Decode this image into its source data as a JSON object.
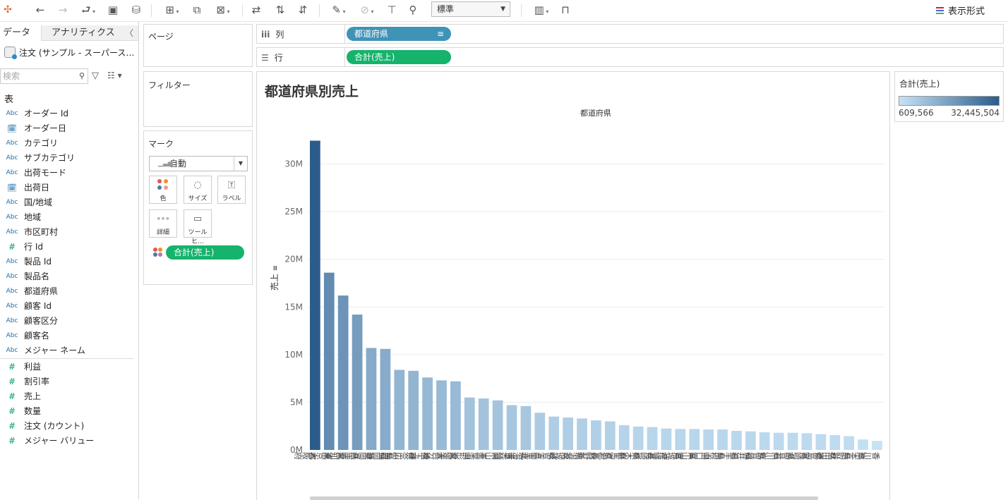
{
  "toolbar": {
    "view_mode": "標準",
    "show_me": "表示形式"
  },
  "data_pane": {
    "tab_data": "データ",
    "tab_analytics": "アナリティクス",
    "datasource": "注文 (サンプル - スーパース…",
    "search_placeholder": "検索",
    "table_label": "表",
    "dimensions": [
      {
        "type": "Abc",
        "name": "オーダー Id"
      },
      {
        "type": "date",
        "name": "オーダー日"
      },
      {
        "type": "Abc",
        "name": "カテゴリ"
      },
      {
        "type": "Abc",
        "name": "サブカテゴリ"
      },
      {
        "type": "Abc",
        "name": "出荷モード"
      },
      {
        "type": "date",
        "name": "出荷日"
      },
      {
        "type": "Abc",
        "name": "国/地域"
      },
      {
        "type": "Abc",
        "name": "地域"
      },
      {
        "type": "Abc",
        "name": "市区町村"
      },
      {
        "type": "#",
        "name": "行 Id"
      },
      {
        "type": "Abc",
        "name": "製品 Id"
      },
      {
        "type": "Abc",
        "name": "製品名"
      },
      {
        "type": "Abc",
        "name": "都道府県"
      },
      {
        "type": "Abc",
        "name": "顧客 Id"
      },
      {
        "type": "Abc",
        "name": "顧客区分"
      },
      {
        "type": "Abc",
        "name": "顧客名"
      },
      {
        "type": "Abc",
        "name": "メジャー ネーム"
      }
    ],
    "measures": [
      {
        "type": "#",
        "name": "利益"
      },
      {
        "type": "#",
        "name": "割引率"
      },
      {
        "type": "#",
        "name": "売上"
      },
      {
        "type": "#",
        "name": "数量"
      },
      {
        "type": "#",
        "name": "注文 (カウント)"
      },
      {
        "type": "#",
        "name": "メジャー バリュー"
      }
    ]
  },
  "cards": {
    "pages": "ページ",
    "filters": "フィルター",
    "marks": "マーク",
    "mark_type": "自動",
    "color": "色",
    "size": "サイズ",
    "label": "ラベル",
    "detail": "詳細",
    "tooltip": "ツールヒ…",
    "marks_pill": "合計(売上)"
  },
  "shelves": {
    "columns_label": "列",
    "rows_label": "行",
    "columns_pill": "都道府県",
    "rows_pill": "合計(売上)"
  },
  "legend": {
    "title": "合計(売上)",
    "min": "609,566",
    "max": "32,445,504",
    "color_low": "#c6e2f5",
    "color_high": "#2c5c8c"
  },
  "chart_data": {
    "type": "bar",
    "title": "都道府県別売上",
    "xlabel": "都道府県",
    "ylabel": "売上",
    "ylim": [
      0,
      33000000
    ],
    "yticks": [
      "0M",
      "5M",
      "10M",
      "15M",
      "20M",
      "25M",
      "30M"
    ],
    "ytick_values": [
      0,
      5000000,
      10000000,
      15000000,
      20000000,
      25000000,
      30000000
    ],
    "categories": [
      "大阪府",
      "東京都",
      "愛知県",
      "兵庫県",
      "静岡県",
      "福岡県",
      "広島県",
      "神奈川県",
      "埼玉県",
      "大分県",
      "愛媛県",
      "山形県",
      "千葉県",
      "岡山県",
      "青森県",
      "北海道",
      "三重県",
      "岐阜県",
      "茨城県",
      "新潟県",
      "長野県",
      "京都府",
      "群馬県",
      "栃木県",
      "長崎県",
      "沖縄県",
      "宮城県",
      "富山県",
      "山口県",
      "島根県",
      "岩手県",
      "福井県",
      "佐賀県",
      "石川県",
      "滋賀県",
      "宮崎県",
      "徳島県",
      "秋田県",
      "鳥取県",
      "熊本県",
      "香川県"
    ],
    "values": [
      32445504,
      18600000,
      16200000,
      14200000,
      10700000,
      10600000,
      8400000,
      8300000,
      7600000,
      7300000,
      7200000,
      5500000,
      5400000,
      5200000,
      4700000,
      4600000,
      3900000,
      3500000,
      3400000,
      3300000,
      3100000,
      3000000,
      2600000,
      2450000,
      2400000,
      2250000,
      2200000,
      2200000,
      2150000,
      2150000,
      2000000,
      1950000,
      1850000,
      1800000,
      1800000,
      1750000,
      1650000,
      1550000,
      1450000,
      1100000,
      950000
    ]
  }
}
